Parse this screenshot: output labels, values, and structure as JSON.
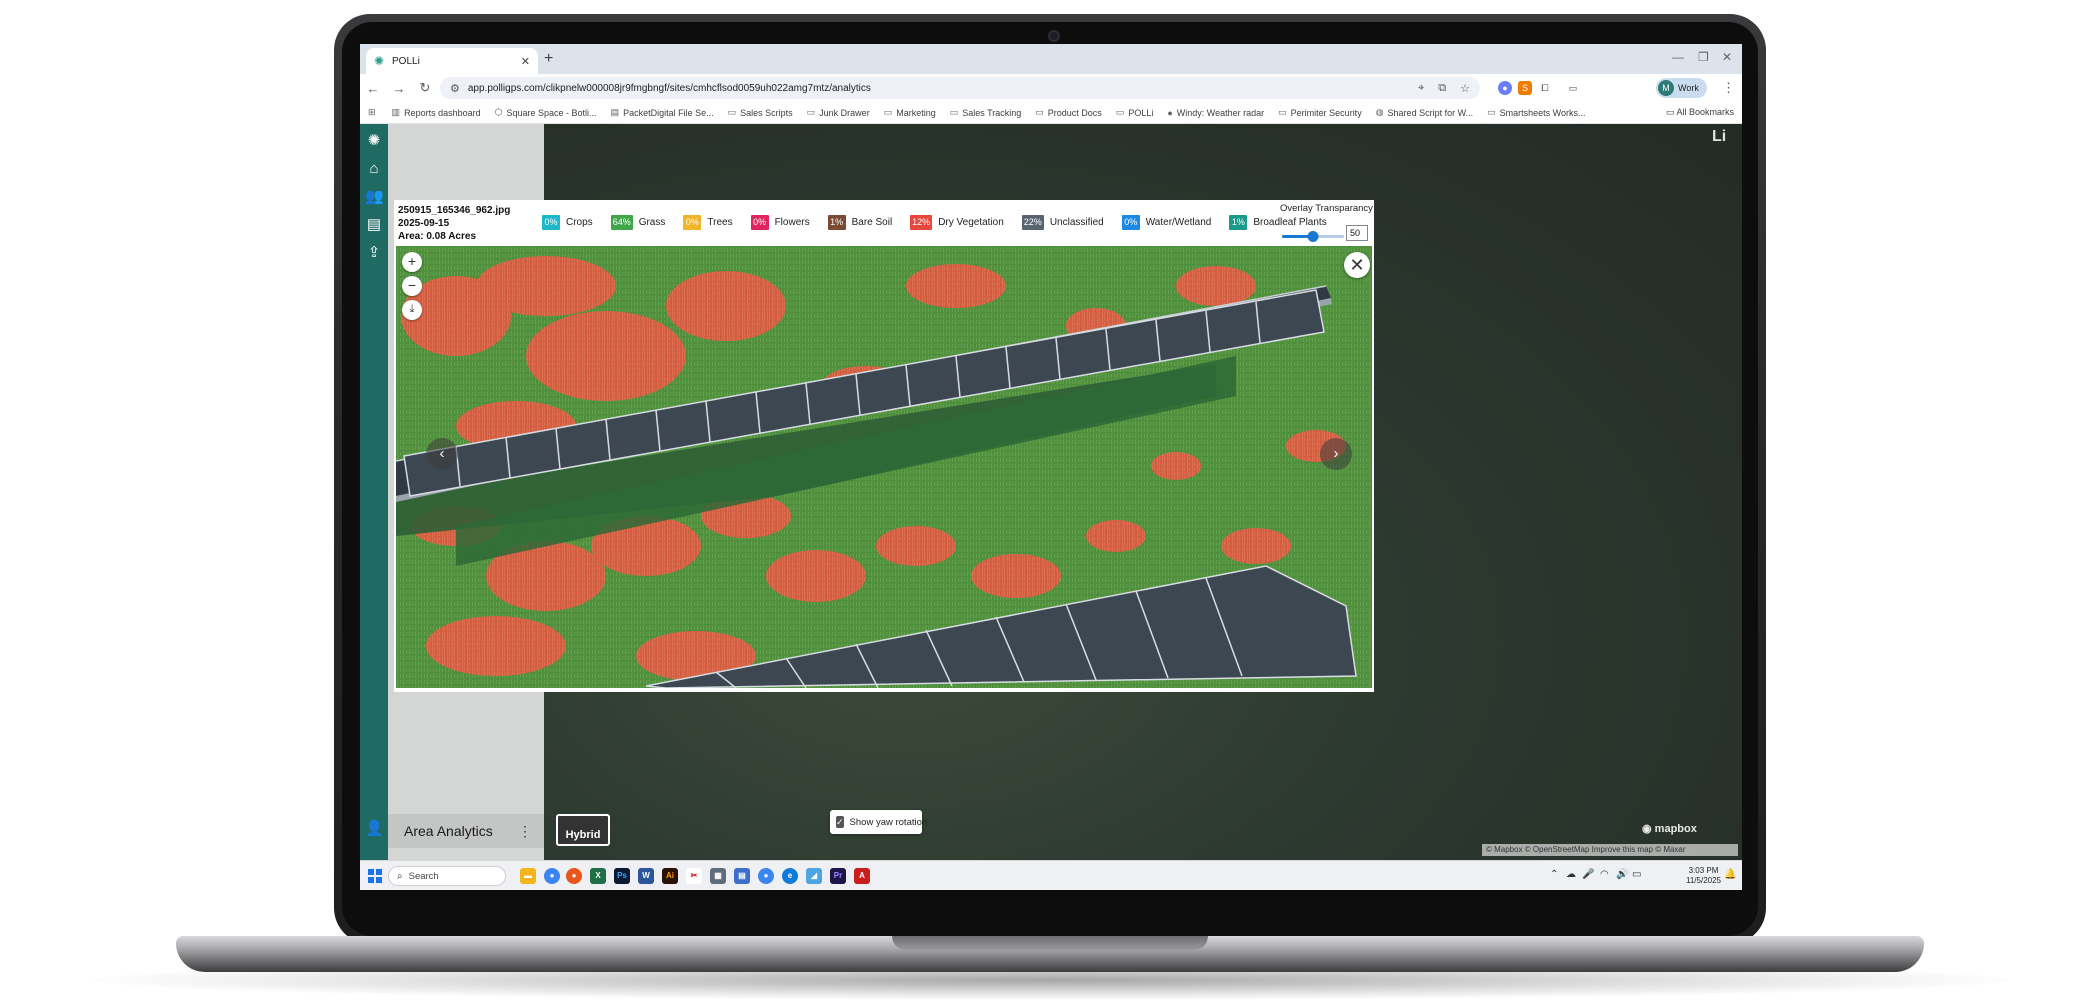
{
  "browser": {
    "tab_title": "POLLi",
    "url": "app.polligps.com/clikpnelw000008jr9fmgbngf/sites/cmhcflsod0059uh022amg7mtz/analytics",
    "profile_label": "Work",
    "profile_initial": "M",
    "bookmarks": [
      {
        "icon": "chart-icon",
        "label": "Reports dashboard"
      },
      {
        "icon": "cube-icon",
        "label": "Square Space - Botli..."
      },
      {
        "icon": "file-icon",
        "label": "PacketDigital File Se..."
      },
      {
        "icon": "folder-icon",
        "label": "Sales Scripts"
      },
      {
        "icon": "folder-icon",
        "label": "Junk Drawer"
      },
      {
        "icon": "folder-icon",
        "label": "Marketing"
      },
      {
        "icon": "folder-icon",
        "label": "Sales Tracking"
      },
      {
        "icon": "folder-icon",
        "label": "Product Docs"
      },
      {
        "icon": "folder-icon",
        "label": "POLLi"
      },
      {
        "icon": "weather-icon",
        "label": "Windy: Weather radar"
      },
      {
        "icon": "folder-icon",
        "label": "Perimiter Security"
      },
      {
        "icon": "globe-icon",
        "label": "Shared Script for W..."
      },
      {
        "icon": "folder-icon",
        "label": "Smartsheets Works..."
      }
    ],
    "all_bookmarks_label": "All Bookmarks"
  },
  "app": {
    "panel_footer_title": "Area Analytics",
    "map_style_label": "Hybrid",
    "yaw_rotation_label": "Show yaw rotation",
    "yaw_rotation_checked": true,
    "mapbox_label": "mapbox",
    "attribution": "© Mapbox © OpenStreetMap  Improve this map © Maxar",
    "brand_partial": "Li"
  },
  "modal": {
    "filename": "250915_165346_962.jpg",
    "date": "2025-09-15",
    "area": "Area: 0.08 Acres",
    "legend": [
      {
        "pct": "0%",
        "label": "Crops",
        "color": "#1fb7c9"
      },
      {
        "pct": "64%",
        "label": "Grass",
        "color": "#3fa64a"
      },
      {
        "pct": "0%",
        "label": "Trees",
        "color": "#f0b429"
      },
      {
        "pct": "0%",
        "label": "Flowers",
        "color": "#e0245e"
      },
      {
        "pct": "1%",
        "label": "Bare Soil",
        "color": "#7a4b33"
      },
      {
        "pct": "12%",
        "label": "Dry Vegetation",
        "color": "#e8483c"
      },
      {
        "pct": "22%",
        "label": "Unclassified",
        "color": "#5a6470"
      },
      {
        "pct": "0%",
        "label": "Water/Wetland",
        "color": "#1e88e5"
      },
      {
        "pct": "1%",
        "label": "Broadleaf Plants",
        "color": "#1a9a8a"
      }
    ],
    "overlay_label": "Overlay Transparancy",
    "overlay_value": "50",
    "overlay_fraction": 0.5
  },
  "taskbar": {
    "search_placeholder": "Search",
    "time": "3:03 PM",
    "date": "11/5/2025"
  }
}
